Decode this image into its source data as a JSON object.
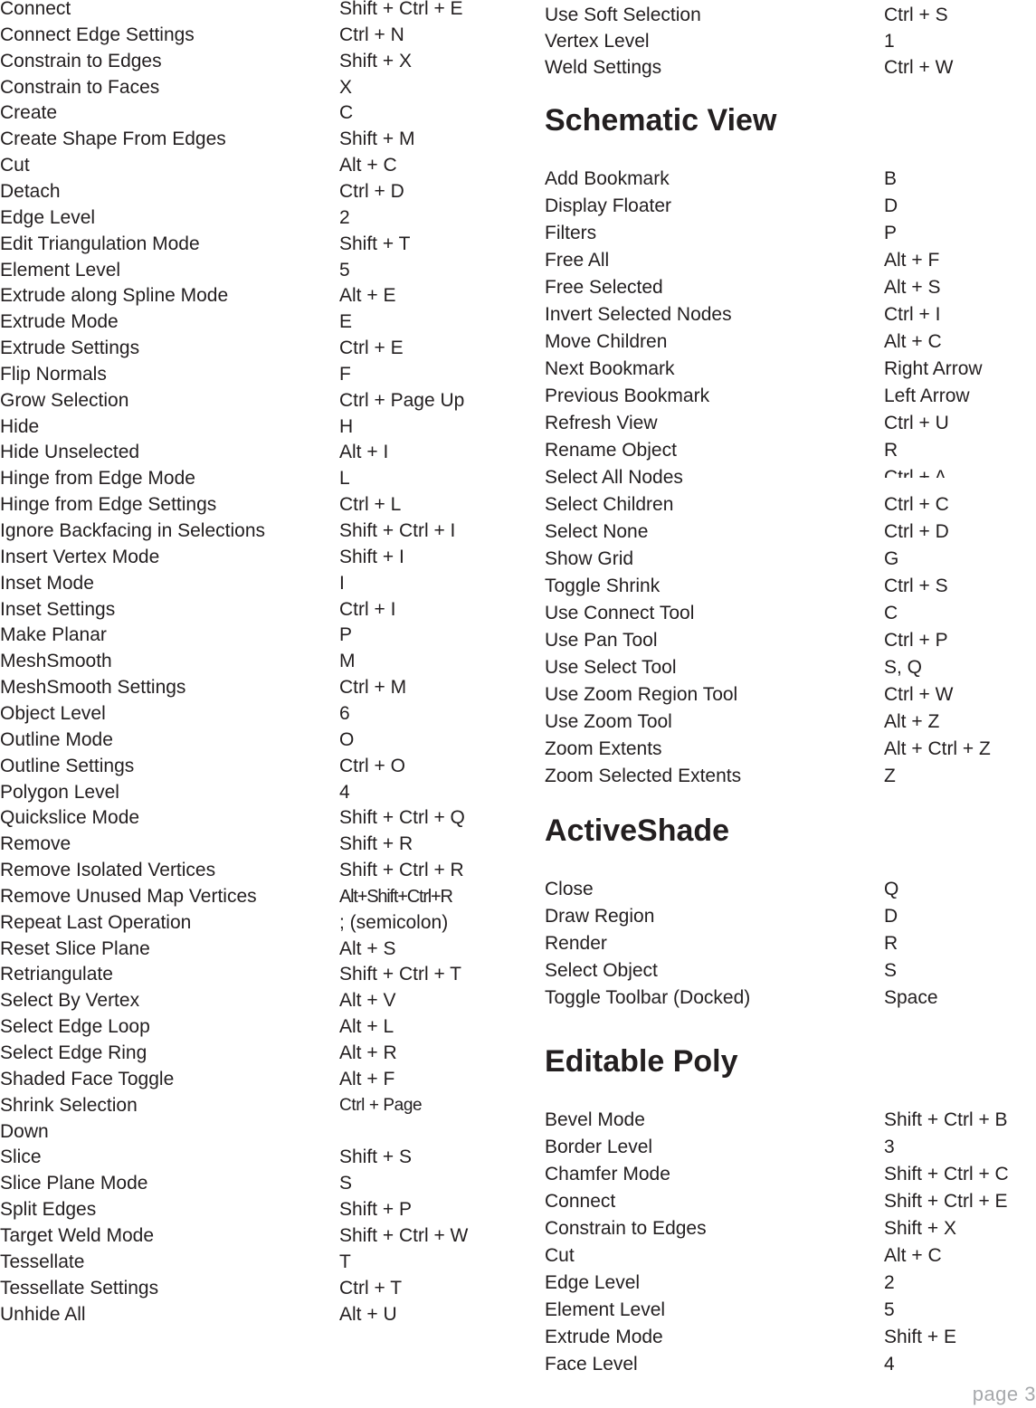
{
  "left_column": {
    "items": [
      {
        "name": "Connect",
        "key": "Shift + Ctrl + E"
      },
      {
        "name": "Connect Edge Settings",
        "key": "Ctrl + N"
      },
      {
        "name": "Constrain to Edges",
        "key": "Shift + X"
      },
      {
        "name": "Constrain to Faces",
        "key": "X"
      },
      {
        "name": "Create",
        "key": "C"
      },
      {
        "name": "Create Shape From Edges",
        "key": "Shift + M"
      },
      {
        "name": "Cut",
        "key": "Alt + C"
      },
      {
        "name": "Detach",
        "key": "Ctrl + D"
      },
      {
        "name": "Edge Level",
        "key": "2"
      },
      {
        "name": "Edit Triangulation Mode",
        "key": "Shift + T"
      },
      {
        "name": "Element Level",
        "key": "5"
      },
      {
        "name": "Extrude along Spline Mode",
        "key": "Alt + E"
      },
      {
        "name": "Extrude Mode",
        "key": "E"
      },
      {
        "name": "Extrude Settings",
        "key": "Ctrl + E"
      },
      {
        "name": "Flip Normals",
        "key": "F"
      },
      {
        "name": "Grow Selection",
        "key": "Ctrl + Page Up"
      },
      {
        "name": "Hide",
        "key": "H"
      },
      {
        "name": "Hide Unselected",
        "key": "Alt + I"
      },
      {
        "name": "Hinge from Edge Mode",
        "key": "L"
      },
      {
        "name": "Hinge from Edge Settings",
        "key": "Ctrl + L"
      },
      {
        "name": "Ignore Backfacing in Selections",
        "key": "Shift + Ctrl + I"
      },
      {
        "name": "Insert Vertex Mode",
        "key": "Shift + I"
      },
      {
        "name": "Inset Mode",
        "key": "I"
      },
      {
        "name": "Inset Settings",
        "key": "Ctrl + I"
      },
      {
        "name": "Make Planar",
        "key": "P"
      },
      {
        "name": "MeshSmooth",
        "key": "M"
      },
      {
        "name": "MeshSmooth Settings",
        "key": "Ctrl + M"
      },
      {
        "name": "Object Level",
        "key": "6"
      },
      {
        "name": "Outline Mode",
        "key": "O"
      },
      {
        "name": "Outline Settings",
        "key": "Ctrl + O"
      },
      {
        "name": "Polygon Level",
        "key": "4"
      },
      {
        "name": "Quickslice Mode",
        "key": "Shift + Ctrl + Q"
      },
      {
        "name": "Remove",
        "key": "Shift + R"
      },
      {
        "name": "Remove Isolated Vertices",
        "key": "Shift + Ctrl + R"
      },
      {
        "name": "Remove Unused Map Vertices",
        "key": "Alt+Shift+Ctrl+R"
      },
      {
        "name": "Repeat Last Operation",
        "key": "; (semicolon)"
      },
      {
        "name": "Reset Slice Plane",
        "key": "Alt + S"
      },
      {
        "name": "Retriangulate",
        "key": "Shift + Ctrl + T"
      },
      {
        "name": "Select By Vertex",
        "key": "Alt + V"
      },
      {
        "name": "Select Edge Loop",
        "key": "Alt + L"
      },
      {
        "name": "Select Edge Ring",
        "key": "Alt + R"
      },
      {
        "name": "Shaded Face Toggle",
        "key": "Alt + F"
      },
      {
        "name": "Shrink Selection",
        "key": "Ctrl + Page"
      },
      {
        "name": "Down",
        "key": ""
      },
      {
        "name": "Slice",
        "key": "Shift + S"
      },
      {
        "name": "Slice Plane Mode",
        "key": "S"
      },
      {
        "name": "Split Edges",
        "key": "Shift + P"
      },
      {
        "name": "Target Weld Mode",
        "key": "Shift + Ctrl + W"
      },
      {
        "name": "Tessellate",
        "key": "T"
      },
      {
        "name": "Tessellate Settings",
        "key": "Ctrl + T"
      },
      {
        "name": "Unhide All",
        "key": "Alt + U"
      }
    ]
  },
  "right_column": {
    "top_items": [
      {
        "name": "Use Soft Selection",
        "key": "Ctrl + S"
      },
      {
        "name": "Vertex Level",
        "key": "1"
      },
      {
        "name": "Weld Settings",
        "key": "Ctrl + W"
      }
    ],
    "sections": [
      {
        "title": "Schematic View",
        "items": [
          {
            "name": "Add Bookmark",
            "key": "B"
          },
          {
            "name": "Display Floater",
            "key": "D"
          },
          {
            "name": "Filters",
            "key": "P"
          },
          {
            "name": "Free All",
            "key": "Alt + F"
          },
          {
            "name": "Free Selected",
            "key": "Alt + S"
          },
          {
            "name": "Invert Selected Nodes",
            "key": "Ctrl + I"
          },
          {
            "name": "Move Children",
            "key": "Alt + C"
          },
          {
            "name": "Next Bookmark",
            "key": "Right Arrow"
          },
          {
            "name": "Previous Bookmark",
            "key": "Left Arrow"
          },
          {
            "name": "Refresh View",
            "key": "Ctrl + U"
          },
          {
            "name": "Rename Object",
            "key": "R"
          },
          {
            "name": "Select All Nodes",
            "key": "Ctrl + A"
          },
          {
            "name": "Select Children",
            "key": "Ctrl + C"
          },
          {
            "name": "Select None",
            "key": "Ctrl + D"
          },
          {
            "name": "Show Grid",
            "key": "G"
          },
          {
            "name": "Toggle Shrink",
            "key": "Ctrl + S"
          },
          {
            "name": "Use Connect Tool",
            "key": "C"
          },
          {
            "name": "Use Pan Tool",
            "key": "Ctrl + P"
          },
          {
            "name": "Use Select Tool",
            "key": "S, Q"
          },
          {
            "name": "Use Zoom Region Tool",
            "key": "Ctrl + W"
          },
          {
            "name": "Use Zoom Tool",
            "key": "Alt + Z"
          },
          {
            "name": "Zoom Extents",
            "key": "Alt + Ctrl + Z"
          },
          {
            "name": "Zoom Selected Extents",
            "key": "Z"
          }
        ]
      },
      {
        "title": "ActiveShade",
        "items": [
          {
            "name": "Close",
            "key": "Q"
          },
          {
            "name": "Draw Region",
            "key": "D"
          },
          {
            "name": "Render",
            "key": "R"
          },
          {
            "name": "Select Object",
            "key": "S"
          },
          {
            "name": "Toggle Toolbar (Docked)",
            "key": "Space"
          }
        ]
      },
      {
        "title": "Editable Poly",
        "items": [
          {
            "name": "Bevel Mode",
            "key": "Shift + Ctrl + B"
          },
          {
            "name": "Border Level",
            "key": "3"
          },
          {
            "name": "Chamfer Mode",
            "key": "Shift + Ctrl + C"
          },
          {
            "name": "Connect",
            "key": "Shift + Ctrl + E"
          },
          {
            "name": "Constrain to Edges",
            "key": "Shift + X"
          },
          {
            "name": "Cut",
            "key": "Alt + C"
          },
          {
            "name": "Edge Level",
            "key": "2"
          },
          {
            "name": "Element Level",
            "key": "5"
          },
          {
            "name": "Extrude Mode",
            "key": "Shift + E"
          },
          {
            "name": "Face Level",
            "key": "4"
          }
        ]
      }
    ]
  },
  "footer": {
    "page_label": "page 3"
  }
}
